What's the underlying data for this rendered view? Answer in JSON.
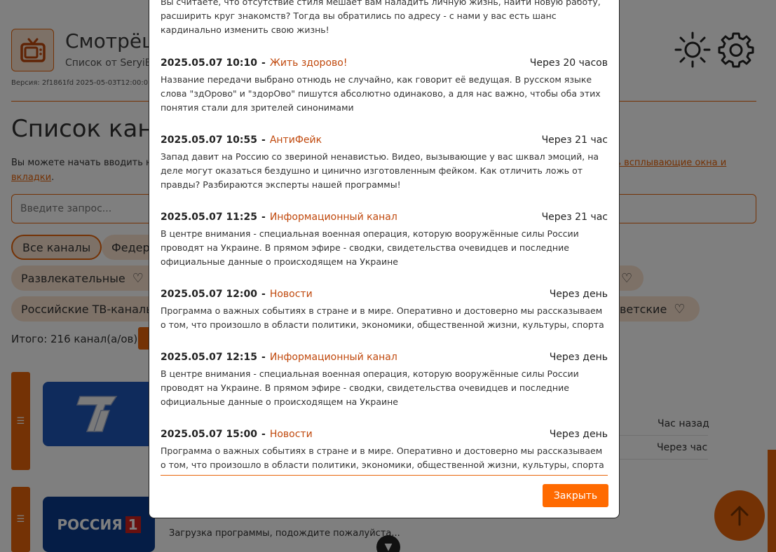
{
  "app": {
    "title": "Смотрёш",
    "subtitle": "Список от SeryiB",
    "version": "Версия: 2f1861fd 2025-05-03T12:00:0"
  },
  "page": {
    "heading": "Список кана",
    "intro": "Вы можете начать вводить ном",
    "intro_link": "ль всплывающие окна и",
    "intro_link2": "вкладки",
    "intro_link2_suffix": ".",
    "search_placeholder": "Введите запрос...",
    "total": "Итого: 216 канал(а/ов)"
  },
  "filters": [
    {
      "label": "Все каналы",
      "active": true
    },
    {
      "label": "Федер",
      "active": false
    },
    {
      "label": "Развлекательные",
      "active": false
    },
    {
      "label": "Российские ТВ-каналь",
      "active": false
    },
    {
      "label": "ветские",
      "active": false
    }
  ],
  "channels": [
    {
      "logo_text": "1",
      "times": [
        "Час назад",
        "Через час"
      ]
    },
    {
      "logo_text": "РОССИЯ",
      "logo_badge": "1",
      "loading": "Загрузка программы, подождите пожалуйста..."
    }
  ],
  "modal": {
    "top_text": "Вы считаете, что отсутствие стиля мешает вам наладить личную жизнь, найти новую работу, расширить круг знакомств? Тогда вы обратились по адресу - с нами у вас есть шанс кардинально изменить свою жизнь!",
    "close_label": "Закрыть",
    "programs": [
      {
        "time": "2025.05.07 10:10",
        "title": "Жить здорово!",
        "relative": "Через 20 часов",
        "description": "Название передачи выбрано отнюдь не случайно, как говорит её ведущая. В русском языке слова \"здОрово\" и \"здорОво\" пишутся абсолютно одинаково, а для нас важно, чтобы оба этих понятия стали для зрителей синонимами"
      },
      {
        "time": "2025.05.07 10:55",
        "title": "АнтиФейк",
        "relative": "Через 21 час",
        "description": "Запад давит на Россию со звериной ненавистью. Видео, вызывающие у вас шквал эмоций, на деле могут оказаться бездушно и цинично изготовленным фейком. Как отличить ложь от правды? Разбираются эксперты нашей программы!"
      },
      {
        "time": "2025.05.07 11:25",
        "title": "Информационный канал",
        "relative": "Через 21 час",
        "description": "В центре внимания - специальная военная операция, которую вооружённые силы России проводят на Украине. В прямом эфире - сводки, свидетельства очевидцев и последние официальные данные о происходящем на Украине"
      },
      {
        "time": "2025.05.07 12:00",
        "title": "Новости",
        "relative": "Через день",
        "description": "Программа о важных событиях в стране и в мире. Оперативно и достоверно мы рассказываем о том, что произошло в области политики, экономики, общественной жизни, культуры, спорта"
      },
      {
        "time": "2025.05.07 12:15",
        "title": "Информационный канал",
        "relative": "Через день",
        "description": "В центре внимания - специальная военная операция, которую вооружённые силы России проводят на Украине. В прямом эфире - сводки, свидетельства очевидцев и последние официальные данные о происходящем на Украине"
      },
      {
        "time": "2025.05.07 15:00",
        "title": "Новости",
        "relative": "Через день",
        "description": "Программа о важных событиях в стране и в мире. Оперативно и достоверно мы рассказываем о том, что произошло в области политики, экономики, общественной жизни, культуры, спорта"
      }
    ]
  },
  "colors": {
    "accent": "#e8650a",
    "chip_bg": "#fbe3cf",
    "title_link": "#c0480c",
    "close_button": "#ff6a00"
  },
  "icons": [
    "tv-icon",
    "sun-icon",
    "gear-icon",
    "heart-icon",
    "list-icon",
    "arrow-up-icon",
    "chevron-down-icon"
  ]
}
